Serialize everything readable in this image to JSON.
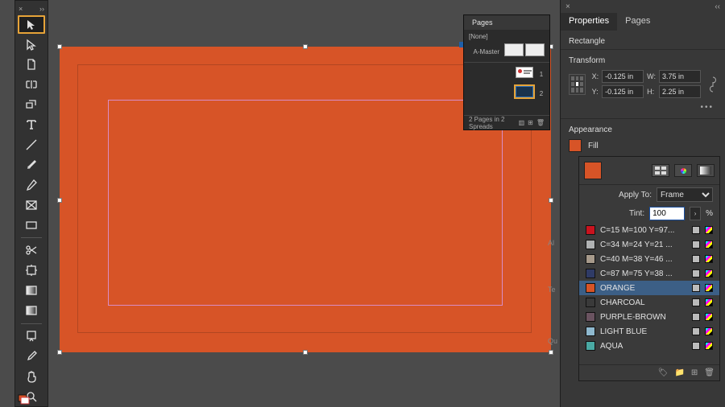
{
  "toolbar": {
    "close_glyph": "×",
    "expand_glyph": "››"
  },
  "pages_panel": {
    "tab_label": "Pages",
    "none_label": "[None]",
    "master_label": "A-Master",
    "page1_label": "1",
    "page2_label": "2",
    "footer_status": "2 Pages in 2 Spreads"
  },
  "inspector": {
    "tabs": {
      "properties": "Properties",
      "pages": "Pages"
    },
    "selection_type": "Rectangle",
    "transform": {
      "title": "Transform",
      "x_label": "X:",
      "y_label": "Y:",
      "w_label": "W:",
      "h_label": "H:",
      "x": "-0.125 in",
      "y": "-0.125 in",
      "w": "3.75 in",
      "h": "2.25 in"
    },
    "appearance_title": "Appearance",
    "fill_label": "Fill",
    "faded": {
      "al": "Al",
      "te": "Te",
      "qu": "Qu"
    },
    "fill_color": "#d75427"
  },
  "swatch_pop": {
    "apply_to_label": "Apply To:",
    "apply_to_value": "Frame",
    "tint_label": "Tint:",
    "tint_value": "100",
    "percent": "%",
    "swatches": [
      {
        "name": "C=15 M=100 Y=97...",
        "color": "#c9131e"
      },
      {
        "name": "C=34 M=24 Y=21 ...",
        "color": "#b0b2b3"
      },
      {
        "name": "C=40 M=38 Y=46 ...",
        "color": "#a79a8b"
      },
      {
        "name": "C=87 M=75 Y=38 ...",
        "color": "#2f3b66"
      },
      {
        "name": "ORANGE",
        "color": "#d75427",
        "selected": true
      },
      {
        "name": "CHARCOAL",
        "color": "#3a3a3a"
      },
      {
        "name": "PURPLE-BROWN",
        "color": "#6a5360"
      },
      {
        "name": "LIGHT BLUE",
        "color": "#8fb9cf"
      },
      {
        "name": "AQUA",
        "color": "#4aa9a3"
      }
    ]
  },
  "colors": {
    "artboard": "#d75427",
    "highlight": "#e6a338"
  }
}
